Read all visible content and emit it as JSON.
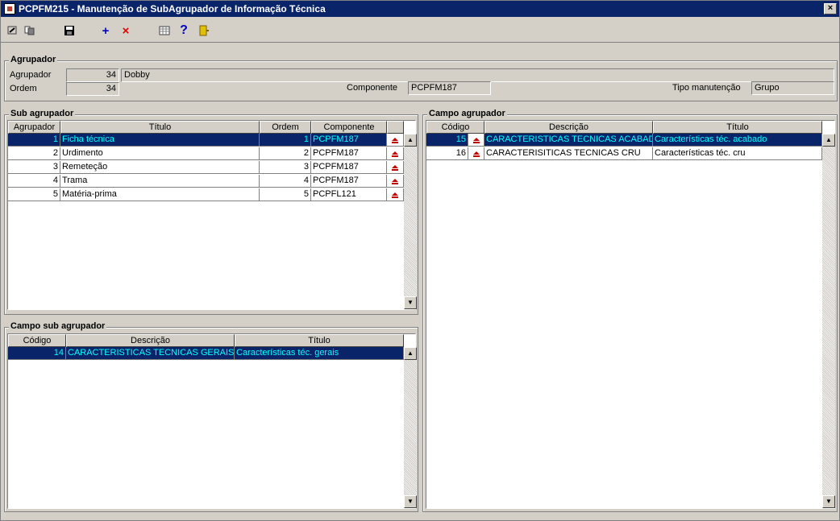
{
  "window": {
    "title": "PCPFM215 - Manutenção de SubAgrupador de Informação Técnica",
    "close": "×"
  },
  "toolbar": {
    "icons": [
      "nav-first-icon",
      "nav-list-icon",
      "save-icon",
      "add-icon",
      "delete-icon",
      "grid-icon",
      "help-icon",
      "exit-icon"
    ],
    "add": "+",
    "delete": "×",
    "help": "?"
  },
  "agrupador": {
    "legend": "Agrupador",
    "label_agrupador": "Agrupador",
    "agrupador_code": "34",
    "agrupador_name": "Dobby",
    "label_ordem": "Ordem",
    "ordem": "34",
    "label_componente": "Componente",
    "componente": "PCPFM187",
    "label_tipo": "Tipo manutenção",
    "tipo": "Grupo"
  },
  "sub_agrupador": {
    "legend": "Sub agrupador",
    "headers": [
      "Agrupador",
      "Título",
      "Ordem",
      "Componente"
    ],
    "rows": [
      {
        "agrupador": "1",
        "titulo": "Ficha técnica",
        "ordem": "1",
        "componente": "PCPFM187",
        "selected": true
      },
      {
        "agrupador": "2",
        "titulo": "Urdimento",
        "ordem": "2",
        "componente": "PCPFM187",
        "selected": false
      },
      {
        "agrupador": "3",
        "titulo": "Remeteção",
        "ordem": "3",
        "componente": "PCPFM187",
        "selected": false
      },
      {
        "agrupador": "4",
        "titulo": "Trama",
        "ordem": "4",
        "componente": "PCPFM187",
        "selected": false
      },
      {
        "agrupador": "5",
        "titulo": "Matéria-prima",
        "ordem": "5",
        "componente": "PCPFL121",
        "selected": false
      }
    ]
  },
  "campo_sub_agrupador": {
    "legend": "Campo sub agrupador",
    "headers": [
      "Código",
      "Descrição",
      "Título"
    ],
    "rows": [
      {
        "codigo": "14",
        "descricao": "CARACTERISTICAS TECNICAS GERAIS",
        "titulo": "Características téc. gerais",
        "selected": true
      }
    ]
  },
  "campo_agrupador": {
    "legend": "Campo agrupador",
    "headers": [
      "Código",
      "Descrição",
      "Título"
    ],
    "rows": [
      {
        "codigo": "15",
        "descricao": "CARACTERISTICAS TECNICAS ACABADO",
        "titulo": "Características téc. acabado",
        "selected": true
      },
      {
        "codigo": "16",
        "descricao": "CARACTERISITICAS TECNICAS CRU",
        "titulo": "Características téc. cru",
        "selected": false
      }
    ]
  },
  "scroll": {
    "up": "▲",
    "down": "▼"
  },
  "colors": {
    "title_bg": "#0a246a",
    "selected_bg": "#0a246a",
    "selected_fg": "#00ffff",
    "window_bg": "#d4d0c8",
    "eject_red": "#c00000"
  }
}
